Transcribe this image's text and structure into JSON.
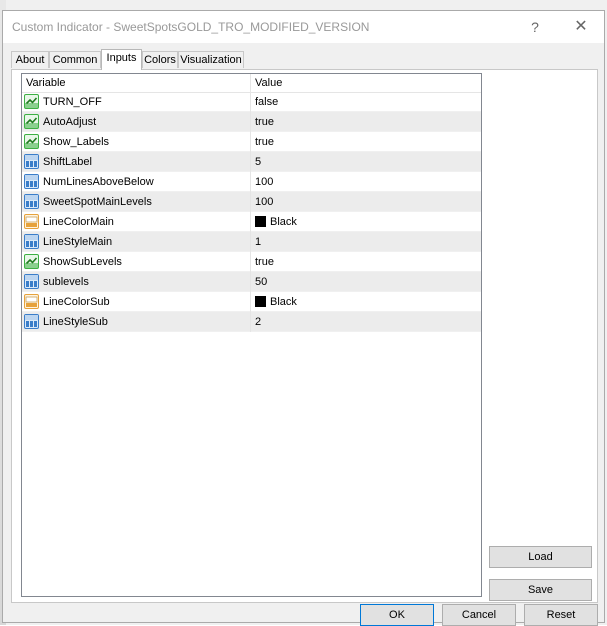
{
  "window": {
    "title": "Custom Indicator - SweetSpotsGOLD_TRO_MODIFIED_VERSION",
    "help_glyph": "?",
    "close_glyph": "✕"
  },
  "tabs": [
    {
      "label": "About",
      "active": false
    },
    {
      "label": "Common",
      "active": false
    },
    {
      "label": "Inputs",
      "active": true
    },
    {
      "label": "Colors",
      "active": false
    },
    {
      "label": "Visualization",
      "active": false
    }
  ],
  "grid": {
    "col_variable": "Variable",
    "col_value": "Value",
    "rows": [
      {
        "name": "TURN_OFF",
        "value": "false",
        "type": "bool",
        "icon": "bool-icon"
      },
      {
        "name": "AutoAdjust",
        "value": "true",
        "type": "bool",
        "icon": "bool-icon"
      },
      {
        "name": "Show_Labels",
        "value": "true",
        "type": "bool",
        "icon": "bool-icon"
      },
      {
        "name": "ShiftLabel",
        "value": "5",
        "type": "int",
        "icon": "integer-icon"
      },
      {
        "name": "NumLinesAboveBelow",
        "value": "100",
        "type": "int",
        "icon": "integer-icon"
      },
      {
        "name": "SweetSpotMainLevels",
        "value": "100",
        "type": "int",
        "icon": "integer-icon"
      },
      {
        "name": "LineColorMain",
        "value": "Black",
        "type": "color",
        "icon": "color-icon",
        "swatch": "#000000"
      },
      {
        "name": "LineStyleMain",
        "value": "1",
        "type": "int",
        "icon": "integer-icon"
      },
      {
        "name": "ShowSubLevels",
        "value": "true",
        "type": "bool",
        "icon": "bool-icon"
      },
      {
        "name": "sublevels",
        "value": "50",
        "type": "int",
        "icon": "integer-icon"
      },
      {
        "name": "LineColorSub",
        "value": "Black",
        "type": "color",
        "icon": "color-icon",
        "swatch": "#000000"
      },
      {
        "name": "LineStyleSub",
        "value": "2",
        "type": "int",
        "icon": "integer-icon"
      }
    ]
  },
  "buttons": {
    "load": "Load",
    "save": "Save",
    "ok": "OK",
    "cancel": "Cancel",
    "reset": "Reset"
  },
  "colors": {
    "accent": "#0078d7",
    "bool_icon": "#3cb043",
    "int_icon": "#3a7dc9",
    "color_icon": "#e6a23c"
  }
}
